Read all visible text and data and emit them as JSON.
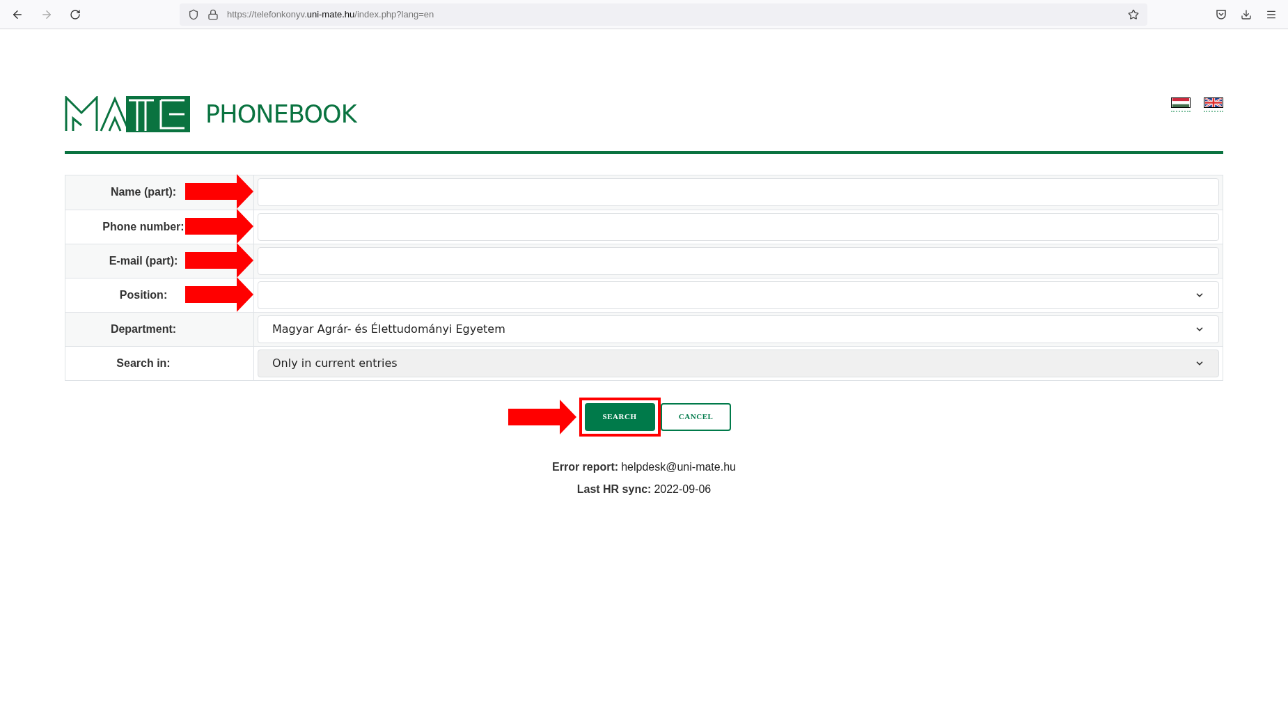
{
  "browser": {
    "url_prefix": "https://telefonkonyv.",
    "url_domain": "uni-mate.hu",
    "url_suffix": "/index.php?lang=en"
  },
  "header": {
    "logo_text": "PHONEBOOK",
    "languages": [
      {
        "kind": "hu"
      },
      {
        "kind": "en"
      }
    ]
  },
  "form": {
    "rows": [
      {
        "label": "Name (part):",
        "kind": "input",
        "value": "",
        "arrow": true
      },
      {
        "label": "Phone number:",
        "kind": "input",
        "value": "",
        "arrow": true
      },
      {
        "label": "E-mail (part):",
        "kind": "input",
        "value": "",
        "arrow": true
      },
      {
        "label": "Position:",
        "kind": "select",
        "value": "",
        "disabled": false,
        "arrow": true
      },
      {
        "label": "Department:",
        "kind": "select",
        "value": "Magyar Agrár- és Élettudományi Egyetem",
        "disabled": false,
        "arrow": false
      },
      {
        "label": "Search in:",
        "kind": "select",
        "value": "Only in current entries",
        "disabled": true,
        "arrow": false
      }
    ]
  },
  "buttons": [
    {
      "label": "SEARCH",
      "kind": "primary",
      "highlighted": true,
      "arrow": true
    },
    {
      "label": "CANCEL",
      "kind": "secondary",
      "highlighted": false,
      "arrow": false
    }
  ],
  "footer": [
    {
      "label": "Error report:",
      "value": "helpdesk@uni-mate.hu"
    },
    {
      "label": "Last HR sync:",
      "value": "2022-09-06"
    }
  ]
}
